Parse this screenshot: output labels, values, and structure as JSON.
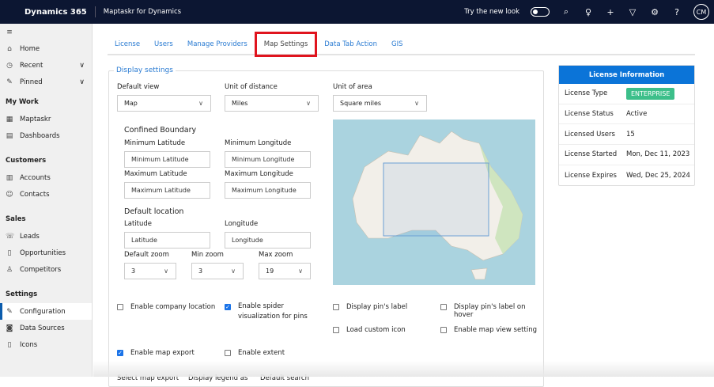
{
  "topbar": {
    "brand": "Dynamics 365",
    "app": "Maptaskr for Dynamics",
    "try_new_look": "Try the new look",
    "avatar": "CM"
  },
  "sidebar": {
    "items_top": [
      {
        "label": "Home",
        "icon": "home-icon"
      },
      {
        "label": "Recent",
        "icon": "clock-icon"
      },
      {
        "label": "Pinned",
        "icon": "pin-icon"
      }
    ],
    "sections": [
      {
        "title": "My Work",
        "items": [
          "Maptaskr",
          "Dashboards"
        ]
      },
      {
        "title": "Customers",
        "items": [
          "Accounts",
          "Contacts"
        ]
      },
      {
        "title": "Sales",
        "items": [
          "Leads",
          "Opportunities",
          "Competitors"
        ]
      },
      {
        "title": "Settings",
        "items": [
          "Configuration",
          "Data Sources",
          "Icons"
        ]
      }
    ],
    "active": "Configuration"
  },
  "tabs": [
    "License",
    "Users",
    "Manage Providers",
    "Map Settings",
    "Data Tab Action",
    "GIS"
  ],
  "selected_tab": "Map Settings",
  "display": {
    "legend": "Display settings",
    "default_view": {
      "label": "Default view",
      "value": "Map"
    },
    "unit_distance": {
      "label": "Unit of distance",
      "value": "Miles"
    },
    "unit_area": {
      "label": "Unit of area",
      "value": "Square miles"
    },
    "confined": "Confined Boundary",
    "min_lat": {
      "label": "Minimum Latitude",
      "placeholder": "Minimum Latitude"
    },
    "min_lon": {
      "label": "Minimum Longitude",
      "placeholder": "Minimum Longitude"
    },
    "max_lat": {
      "label": "Maximum Latitude",
      "placeholder": "Maximum Latitude"
    },
    "max_lon": {
      "label": "Maximum Longitude",
      "placeholder": "Maximum Longitude"
    },
    "default_location": "Default location",
    "lat": {
      "label": "Latitude",
      "placeholder": "Latitude"
    },
    "lon": {
      "label": "Longitude",
      "placeholder": "Longitude"
    },
    "default_zoom": {
      "label": "Default zoom",
      "value": "3"
    },
    "min_zoom": {
      "label": "Min zoom",
      "value": "3"
    },
    "max_zoom": {
      "label": "Max zoom",
      "value": "19"
    },
    "checkboxes": [
      {
        "label": "Enable company location",
        "checked": false
      },
      {
        "label": "Enable spider visualization for pins",
        "checked": true
      },
      {
        "label": "Display pin's label",
        "checked": false
      },
      {
        "label": "Display pin's label on hover",
        "checked": false
      },
      {
        "label": "Load custom icon",
        "checked": false
      },
      {
        "label": "Enable map view setting",
        "checked": false
      },
      {
        "label": "Enable map export",
        "checked": true
      },
      {
        "label": "Enable extent",
        "checked": false
      }
    ],
    "bottom_labels": [
      "Select map export",
      "Display legend as",
      "Default search"
    ]
  },
  "license": {
    "title": "License Information",
    "rows": [
      {
        "k": "License Type",
        "v": "ENTERPRISE"
      },
      {
        "k": "License Status",
        "v": "Active"
      },
      {
        "k": "Licensed Users",
        "v": "15"
      },
      {
        "k": "License Started",
        "v": "Mon, Dec 11, 2023"
      },
      {
        "k": "License Expires",
        "v": "Wed, Dec 25, 2024"
      }
    ]
  },
  "colors": {
    "topbar": "#0c1632",
    "accent": "#2a7bd2",
    "highlight": "#e0141e",
    "badge": "#3cbf8a"
  }
}
